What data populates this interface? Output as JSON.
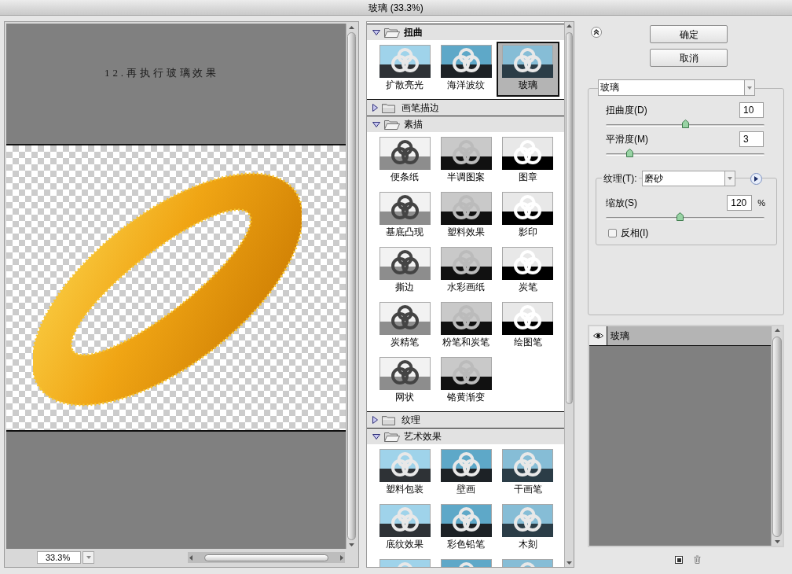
{
  "window": {
    "title": "玻璃 (33.3%)"
  },
  "preview": {
    "caption": "12.再执行玻璃效果",
    "zoom": "33.3%"
  },
  "gallery": {
    "categories": [
      {
        "name": "扭曲",
        "expanded": true,
        "filters": [
          {
            "label": "扩散亮光",
            "selected": false
          },
          {
            "label": "海洋波纹",
            "selected": false
          },
          {
            "label": "玻璃",
            "selected": true
          }
        ]
      },
      {
        "name": "画笔描边",
        "expanded": false
      },
      {
        "name": "素描",
        "expanded": true,
        "filters": [
          {
            "label": "便条纸",
            "selected": false
          },
          {
            "label": "半调图案",
            "selected": false
          },
          {
            "label": "图章",
            "selected": false
          },
          {
            "label": "基底凸现",
            "selected": false
          },
          {
            "label": "塑料效果",
            "selected": false
          },
          {
            "label": "影印",
            "selected": false
          },
          {
            "label": "撕边",
            "selected": false
          },
          {
            "label": "水彩画纸",
            "selected": false
          },
          {
            "label": "炭笔",
            "selected": false
          },
          {
            "label": "炭精笔",
            "selected": false
          },
          {
            "label": "粉笔和炭笔",
            "selected": false
          },
          {
            "label": "绘图笔",
            "selected": false
          },
          {
            "label": "网状",
            "selected": false
          },
          {
            "label": "铬黄渐变",
            "selected": false
          }
        ]
      },
      {
        "name": "纹理",
        "expanded": false
      },
      {
        "name": "艺术效果",
        "expanded": true,
        "filters": [
          {
            "label": "塑料包装",
            "selected": false
          },
          {
            "label": "壁画",
            "selected": false
          },
          {
            "label": "干画笔",
            "selected": false
          },
          {
            "label": "底纹效果",
            "selected": false
          },
          {
            "label": "彩色铅笔",
            "selected": false
          },
          {
            "label": "木刻",
            "selected": false
          },
          {
            "selected": false
          },
          {
            "selected": false
          },
          {
            "selected": false
          }
        ]
      }
    ]
  },
  "actions": [
    "确定",
    "取消"
  ],
  "settings": {
    "filter": "玻璃",
    "sliders": [
      {
        "label": "扭曲度(D)",
        "value": "10",
        "level": 0.5
      },
      {
        "label": "平滑度(M)",
        "value": "3",
        "level": 0.15
      }
    ],
    "texture": {
      "label": "纹理(T):",
      "value": "磨砂",
      "scaling": {
        "label": "缩放(S)",
        "value": "120",
        "unit": "%",
        "level": 0.47
      },
      "invert": {
        "label": "反相(I)",
        "checked": false
      }
    }
  },
  "effect_layers": [
    {
      "name": "玻璃",
      "visible": true,
      "selected": true
    }
  ]
}
